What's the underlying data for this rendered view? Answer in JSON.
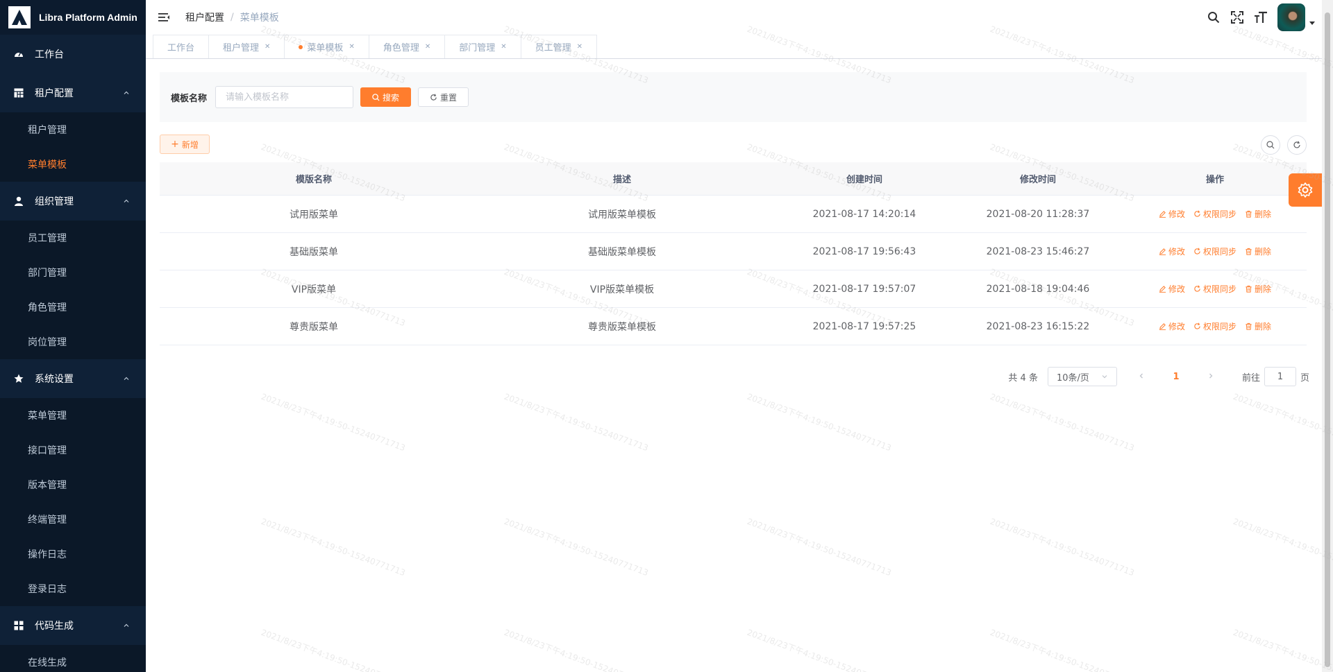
{
  "app": {
    "title": "Libra Platform Admin"
  },
  "sidebar": {
    "groups": [
      {
        "label": "工作台",
        "icon": "dashboard-icon",
        "items": []
      },
      {
        "label": "租户配置",
        "icon": "grid-icon",
        "items": [
          "租户管理",
          "菜单模板"
        ],
        "active": "菜单模板"
      },
      {
        "label": "组织管理",
        "icon": "user-icon",
        "items": [
          "员工管理",
          "部门管理",
          "角色管理",
          "岗位管理"
        ]
      },
      {
        "label": "系统设置",
        "icon": "star-icon",
        "items": [
          "菜单管理",
          "接口管理",
          "版本管理",
          "终端管理",
          "操作日志",
          "登录日志"
        ]
      },
      {
        "label": "代码生成",
        "icon": "apps-icon",
        "items": [
          "在线生成"
        ]
      }
    ]
  },
  "header": {
    "breadcrumb": [
      "租户配置",
      "菜单模板"
    ]
  },
  "tags": [
    {
      "label": "工作台",
      "closable": false,
      "active": false
    },
    {
      "label": "租户管理",
      "closable": true,
      "active": false
    },
    {
      "label": "菜单模板",
      "closable": true,
      "active": true
    },
    {
      "label": "角色管理",
      "closable": true,
      "active": false
    },
    {
      "label": "部门管理",
      "closable": true,
      "active": false
    },
    {
      "label": "员工管理",
      "closable": true,
      "active": false
    }
  ],
  "search": {
    "label": "模板名称",
    "placeholder": "请输入模板名称",
    "search_label": "搜索",
    "reset_label": "重置"
  },
  "toolbar": {
    "add_label": "新增"
  },
  "table": {
    "columns": [
      "模版名称",
      "描述",
      "创建时间",
      "修改时间",
      "操作"
    ],
    "rows": [
      {
        "name": "试用版菜单",
        "desc": "试用版菜单模板",
        "created": "2021-08-17 14:20:14",
        "modified": "2021-08-20 11:28:37"
      },
      {
        "name": "基础版菜单",
        "desc": "基础版菜单模板",
        "created": "2021-08-17 19:56:43",
        "modified": "2021-08-23 15:46:27"
      },
      {
        "name": "VIP版菜单",
        "desc": "VIP版菜单模板",
        "created": "2021-08-17 19:57:07",
        "modified": "2021-08-18 19:04:46"
      },
      {
        "name": "尊贵版菜单",
        "desc": "尊贵版菜单模板",
        "created": "2021-08-17 19:57:25",
        "modified": "2021-08-23 16:15:22"
      }
    ],
    "actions": [
      "修改",
      "权限同步",
      "删除"
    ]
  },
  "pagination": {
    "total": "共 4 条",
    "page_size": "10条/页",
    "current": "1",
    "goto_prefix": "前往",
    "goto_value": "1",
    "goto_suffix": "页"
  },
  "watermark": "2021/8/23下午4:19:50-15240771713",
  "colors": {
    "accent": "#ff7d2d",
    "sidebar": "#0f2137"
  }
}
